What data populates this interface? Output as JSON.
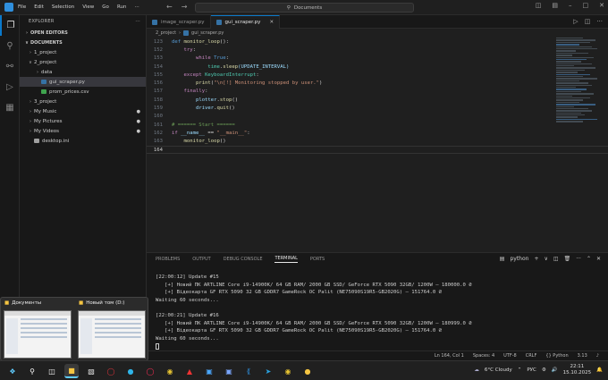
{
  "menu": [
    "File",
    "Edit",
    "Selection",
    "View",
    "Go",
    "Run",
    "···"
  ],
  "search": {
    "text": "Documents"
  },
  "sidebar": {
    "header": "EXPLORER",
    "open_editors": "OPEN EDITORS",
    "root": "DOCUMENTS",
    "items": [
      {
        "label": "1_project",
        "chevron": "›",
        "depth": 1,
        "type": "folder"
      },
      {
        "label": "2_project",
        "chevron": "∨",
        "depth": 1,
        "type": "folder"
      },
      {
        "label": "data",
        "chevron": "›",
        "depth": 2,
        "type": "folder"
      },
      {
        "label": "gui_scraper.py",
        "chevron": "",
        "depth": 2,
        "type": "py",
        "selected": true
      },
      {
        "label": "prom_prices.csv",
        "chevron": "",
        "depth": 2,
        "type": "csv"
      },
      {
        "label": "3_project",
        "chevron": "›",
        "depth": 1,
        "type": "folder"
      },
      {
        "label": "My Music",
        "chevron": "›",
        "depth": 1,
        "type": "folder",
        "badge": "●"
      },
      {
        "label": "My Pictures",
        "chevron": "›",
        "depth": 1,
        "type": "folder",
        "badge": "●"
      },
      {
        "label": "My Videos",
        "chevron": "›",
        "depth": 1,
        "type": "folder",
        "badge": "●"
      },
      {
        "label": "desktop.ini",
        "chevron": "",
        "depth": 1,
        "type": "ini"
      }
    ]
  },
  "tabs": [
    {
      "label": "image_scraper.py",
      "active": false
    },
    {
      "label": "gui_scraper.py",
      "active": true
    }
  ],
  "breadcrumb": [
    "2_project",
    "gui_scraper.py"
  ],
  "code": [
    {
      "n": "123",
      "spans": [
        [
          "def ",
          "#569cd6"
        ],
        [
          "monitor_loop",
          "#dcdcaa"
        ],
        [
          "():",
          "#d4d4d4"
        ]
      ]
    },
    {
      "n": "152",
      "spans": [
        [
          "    ",
          "#d4d4d4"
        ],
        [
          "try",
          "#c586c0"
        ],
        [
          ":",
          "#d4d4d4"
        ]
      ]
    },
    {
      "n": "153",
      "spans": [
        [
          "        ",
          "#d4d4d4"
        ],
        [
          "while ",
          "#c586c0"
        ],
        [
          "True",
          "#569cd6"
        ],
        [
          ":",
          "#d4d4d4"
        ]
      ]
    },
    {
      "n": "154",
      "spans": [
        [
          "            ",
          "#d4d4d4"
        ],
        [
          "time",
          "#4ec9b0"
        ],
        [
          ".",
          "#d4d4d4"
        ],
        [
          "sleep",
          "#dcdcaa"
        ],
        [
          "(UPDATE_INTERVAL)",
          "#9cdcfe"
        ]
      ]
    },
    {
      "n": "155",
      "spans": [
        [
          "    ",
          "#d4d4d4"
        ],
        [
          "except ",
          "#c586c0"
        ],
        [
          "KeyboardInterrupt",
          "#4ec9b0"
        ],
        [
          ":",
          "#d4d4d4"
        ]
      ]
    },
    {
      "n": "156",
      "spans": [
        [
          "        ",
          "#d4d4d4"
        ],
        [
          "print",
          "#dcdcaa"
        ],
        [
          "(",
          "#d4d4d4"
        ],
        [
          "\"\\n[!] Monitoring stopped by user.\"",
          "#ce9178"
        ],
        [
          ")",
          "#d4d4d4"
        ]
      ]
    },
    {
      "n": "157",
      "spans": [
        [
          "    ",
          "#d4d4d4"
        ],
        [
          "finally",
          "#c586c0"
        ],
        [
          ":",
          "#d4d4d4"
        ]
      ]
    },
    {
      "n": "158",
      "spans": [
        [
          "        ",
          "#d4d4d4"
        ],
        [
          "plotter",
          "#9cdcfe"
        ],
        [
          ".",
          "#d4d4d4"
        ],
        [
          "stop",
          "#dcdcaa"
        ],
        [
          "()",
          "#d4d4d4"
        ]
      ]
    },
    {
      "n": "159",
      "spans": [
        [
          "        ",
          "#d4d4d4"
        ],
        [
          "driver",
          "#9cdcfe"
        ],
        [
          ".",
          "#d4d4d4"
        ],
        [
          "quit",
          "#dcdcaa"
        ],
        [
          "()",
          "#d4d4d4"
        ]
      ]
    },
    {
      "n": "160",
      "spans": []
    },
    {
      "n": "161",
      "spans": [
        [
          "# ====== Start ======",
          "#6a9955"
        ]
      ]
    },
    {
      "n": "162",
      "spans": [
        [
          "if ",
          "#c586c0"
        ],
        [
          "__name__",
          "#9cdcfe"
        ],
        [
          " == ",
          "#d4d4d4"
        ],
        [
          "\"__main__\"",
          "#ce9178"
        ],
        [
          ":",
          "#d4d4d4"
        ]
      ]
    },
    {
      "n": "163",
      "spans": [
        [
          "    ",
          "#d4d4d4"
        ],
        [
          "monitor_loop",
          "#dcdcaa"
        ],
        [
          "()",
          "#d4d4d4"
        ]
      ]
    },
    {
      "n": "164",
      "spans": [],
      "current": true
    }
  ],
  "panel": {
    "tabs": [
      "PROBLEMS",
      "OUTPUT",
      "DEBUG CONSOLE",
      "TERMINAL",
      "PORTS"
    ],
    "active_tab": "TERMINAL",
    "shell": "python",
    "terminal": [
      "[22:00:12] Update #15",
      "   [+] Новий ПК ARTLINE Core i9-14900K/ 64 GB RAM/ 2000 GB SSD/ GeForce RTX 5090 32GB/ 1200W — 180000.0 ₴",
      "   [+] Відеокарта GF RTX 5090 32 GB GDDR7 GameRock OC Palit (NE75090S19R5-GB2020G) — 151764.0 ₴",
      "Waiting 60 seconds...",
      "",
      "[22:00:21] Update #16",
      "   [+] Новий ПК ARTLINE Core i9-14900K/ 64 GB RAM/ 2000 GB SSD/ GeForce RTX 5090 32GB/ 1200W — 180999.0 ₴",
      "   [+] Відеокарта GF RTX 5090 32 GB GDDR7 GameRock OC Palit (NE75090S19R5-GB2020G) — 151764.0 ₴",
      "Waiting 60 seconds..."
    ]
  },
  "status": [
    "Ln 164, Col 1",
    "Spaces: 4",
    "UTF-8",
    "CRLF",
    "{} Python",
    "3.13"
  ],
  "taskbar_thumbs": [
    {
      "title": "Документы"
    },
    {
      "title": "Новый том (D:)"
    }
  ],
  "tray": {
    "weather": "6°C  Cloudy",
    "lang": "РУС",
    "time": "22:11",
    "date": "15.10.2025"
  },
  "colors": {
    "accent": "#0a7acc",
    "bg": "#1f1f1f",
    "sidebar_bg": "#181818"
  }
}
